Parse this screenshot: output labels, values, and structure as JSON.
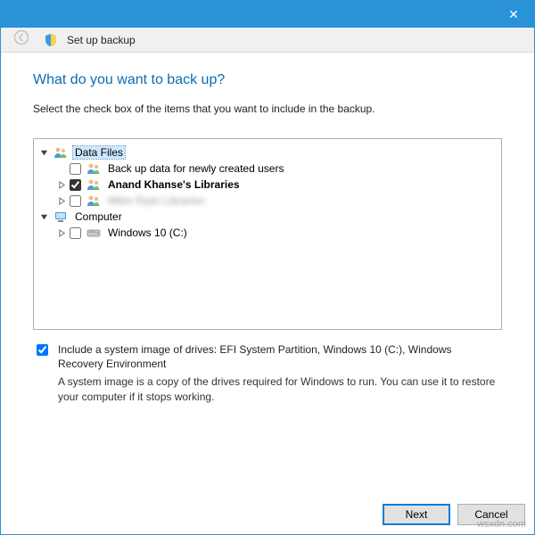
{
  "titlebar": {
    "close": "✕"
  },
  "subheader": {
    "title": "Set up backup"
  },
  "heading": "What do you want to back up?",
  "instruction": "Select the check box of the items that you want to include in the backup.",
  "tree": {
    "data_files": {
      "label": "Data Files",
      "child_newusers": "Back up data for newly created users",
      "child_user_lib": "Anand Khanse's Libraries",
      "child_blurred": "Miles Ryan Libraries"
    },
    "computer": {
      "label": "Computer",
      "child_drive": "Windows 10 (C:)"
    }
  },
  "sysimage": {
    "label": "Include a system image of drives: EFI System Partition, Windows 10 (C:), Windows Recovery Environment",
    "desc": "A system image is a copy of the drives required for Windows to run. You can use it to restore your computer if it stops working."
  },
  "buttons": {
    "next": "Next",
    "cancel": "Cancel"
  },
  "watermark": "wsxdn.com"
}
